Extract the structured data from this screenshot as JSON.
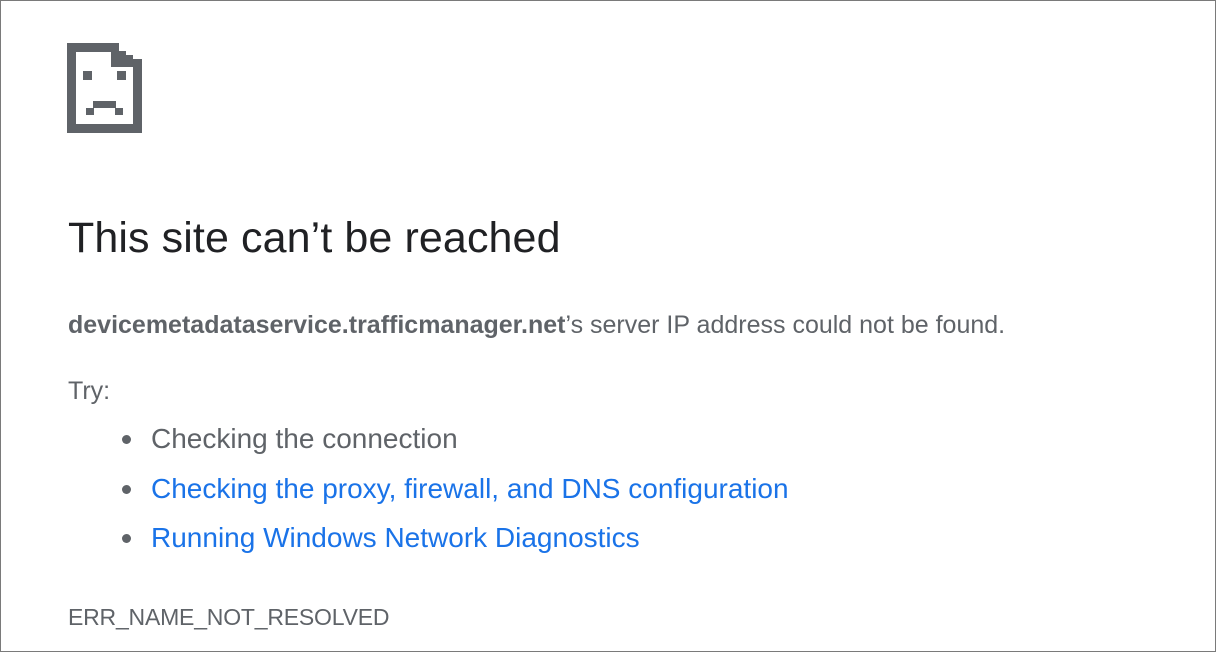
{
  "icon": "sad-page-icon",
  "colors": {
    "title": "#202124",
    "body": "#5f6368",
    "link": "#1a73e8",
    "icon": "#5f6368"
  },
  "error_page": {
    "title": "This site can’t be reached",
    "host": "devicemetadataservice.trafficmanager.net",
    "summary_suffix": "’s server IP address could not be found.",
    "try_label": "Try:",
    "suggestions": [
      {
        "text": "Checking the connection",
        "is_link": false
      },
      {
        "text": "Checking the proxy, firewall, and DNS configuration",
        "is_link": true
      },
      {
        "text": "Running Windows Network Diagnostics",
        "is_link": true
      }
    ],
    "error_code": "ERR_NAME_NOT_RESOLVED"
  }
}
